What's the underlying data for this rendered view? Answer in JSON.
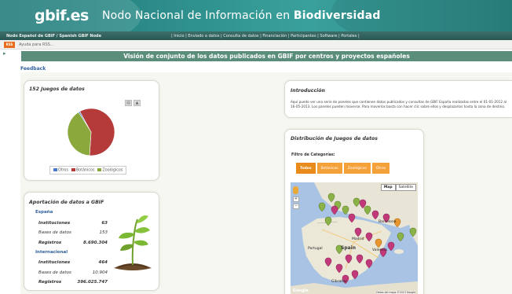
{
  "header": {
    "logo_text": "gbif.es",
    "title_prefix": "Nodo Nacional de Información en ",
    "title_emphasis": "Biodiversidad"
  },
  "nav": {
    "node_label": "Nodo Español de GBIF / Spanish GBIF Node",
    "links": "| Inicio | Enviado a datos | Consulta de datos | Financiación | Participantes | Software | Portales |"
  },
  "subbar": {
    "rss": "RSS",
    "help": "Ayuda para RSS..."
  },
  "page": {
    "section_title": "Visión de conjunto de los datos publicados en GBIF por centros y proyectos españoles",
    "feedback_link": "Feedback"
  },
  "datasets_panel": {
    "title": "152 Juegos de datos",
    "legend": [
      {
        "label": "Otros",
        "color": "#4b7bc8"
      },
      {
        "label": "Botánicos",
        "color": "#b53a3a"
      },
      {
        "label": "Zoológicos",
        "color": "#8aa83c"
      }
    ],
    "chart_data": {
      "type": "pie",
      "categories": [
        "Otros",
        "Botánicos",
        "Zoológicos"
      ],
      "values": [
        1,
        59,
        40
      ],
      "colors": [
        "#4b7bc8",
        "#b53a3a",
        "#8aa83c"
      ]
    }
  },
  "contrib_panel": {
    "title": "Aportación de datos a GBIF",
    "spain": {
      "label": "España",
      "instituciones_label": "Instituciones",
      "instituciones": "63",
      "bases_label": "Bases de datos",
      "bases": "153",
      "registros_label": "Registros",
      "registros": "8.690.304"
    },
    "intl": {
      "label": "Internacional",
      "instituciones_label": "Instituciones",
      "instituciones": "464",
      "bases_label": "Bases de datos",
      "bases": "10.904",
      "registros_label": "Registros",
      "registros": "396.025.747"
    }
  },
  "intro_panel": {
    "title": "Introducción",
    "text": "Aquí puede ver una serie de paneles que contienen datos publicados y consultas de GBIF España realizadas entre el 01-01-2012 al 16-05-2013. Los paneles pueden moverse. Para moverlos basta con hacer clic sobre ellos y desplazarlos hasta la zona de destino."
  },
  "map_panel": {
    "title": "Distribución de Juegos de datos",
    "filter_label": "Filtro de Categorías:",
    "filters": [
      "Todos",
      "Botánicos",
      "Zoológicos",
      "Otros"
    ],
    "map_types": [
      "Map",
      "Satellite"
    ],
    "labels": {
      "spain": "Spain",
      "portugal": "Portugal",
      "madrid": "Madrid",
      "barcelona": "Barcelona",
      "valencia": "Valencia",
      "gibraltar": "Gibraltar"
    },
    "footer": "Datos del mapa ©2013 Google",
    "google": "Google"
  }
}
